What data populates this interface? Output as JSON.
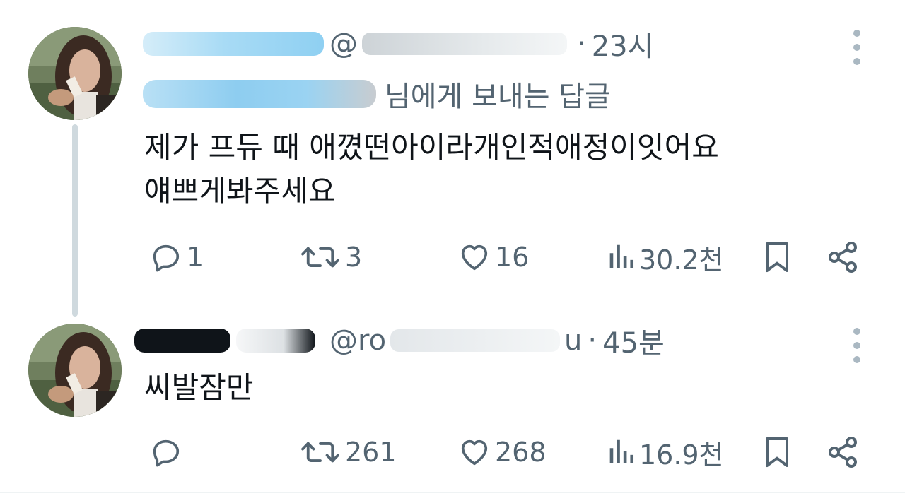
{
  "tweets": [
    {
      "time": "23시",
      "handle_prefix": "@",
      "reply_to_suffix": "님에게 보내는 답글",
      "text_lines": [
        "제가 프듀 때 애꼈떤아이라개인적애정이잇어요",
        "얘쁘게봐주세요"
      ],
      "actions": {
        "replies": "1",
        "retweets": "3",
        "likes": "16",
        "views": "30.2천"
      }
    },
    {
      "time": "45분",
      "handle_prefix": "@ro",
      "handle_suffix": "u",
      "text_lines": [
        "씨발잠만"
      ],
      "actions": {
        "replies": "",
        "retweets": "261",
        "likes": "268",
        "views": "16.9천"
      }
    }
  ],
  "separator": "·",
  "colors": {
    "text": "#0f1419",
    "secondary": "#536471",
    "thread_line": "#cfd9de",
    "link": "#1d9bf0"
  },
  "icons": [
    "reply-icon",
    "retweet-icon",
    "like-icon",
    "views-icon",
    "bookmark-icon",
    "share-icon",
    "more-icon"
  ]
}
